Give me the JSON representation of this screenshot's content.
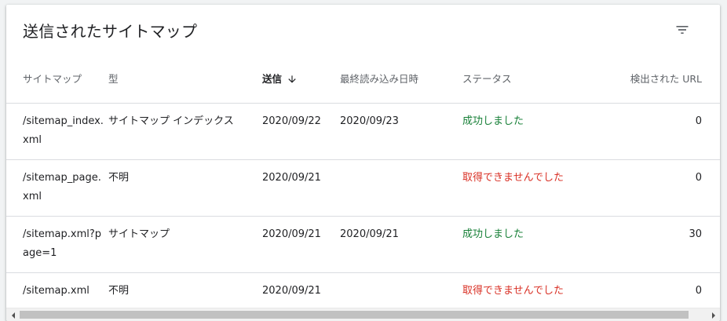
{
  "card": {
    "title": "送信されたサイトマップ"
  },
  "table": {
    "headers": {
      "sitemap": "サイトマップ",
      "type": "型",
      "submitted": "送信",
      "last_read": "最終読み込み日時",
      "status": "ステータス",
      "discovered": "検出された URL"
    },
    "rows": [
      {
        "sitemap": "/sitemap_index.xml",
        "type": "サイトマップ インデックス",
        "submitted": "2020/09/22",
        "last_read": "2020/09/23",
        "status": "成功しました",
        "discovered": "0"
      },
      {
        "sitemap": "/sitemap_page.xml",
        "type": "不明",
        "submitted": "2020/09/21",
        "last_read": "",
        "status": "取得できませんでした",
        "discovered": "0"
      },
      {
        "sitemap": "/sitemap.xml?page=1",
        "type": "サイトマップ",
        "submitted": "2020/09/21",
        "last_read": "2020/09/21",
        "status": "成功しました",
        "discovered": "30"
      },
      {
        "sitemap": "/sitemap.xml",
        "type": "不明",
        "submitted": "2020/09/21",
        "last_read": "",
        "status": "取得できませんでした",
        "discovered": "0"
      }
    ]
  },
  "colors": {
    "success": "#188038",
    "error": "#d93025"
  },
  "icons": {
    "filter": "filter-list-icon",
    "sort": "arrow-downward-icon"
  }
}
